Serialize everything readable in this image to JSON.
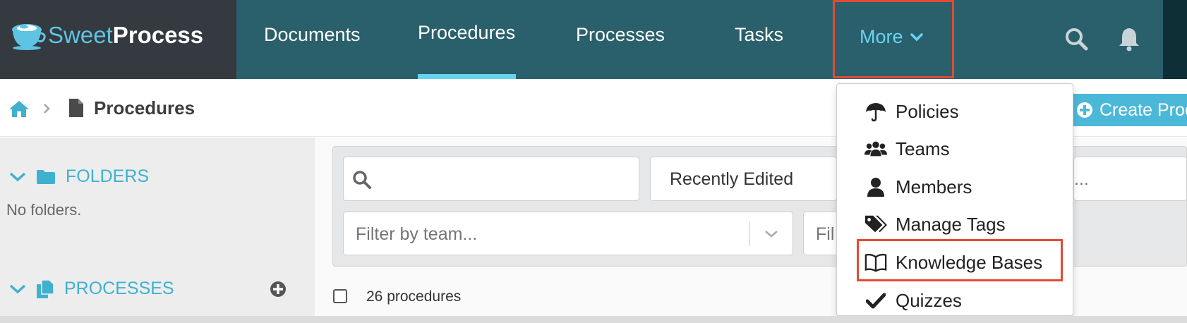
{
  "brand": {
    "part1": "Sweet",
    "part2": "Process",
    "logo_icon": "coffee-cup-logo"
  },
  "nav": {
    "items": [
      {
        "label": "Documents"
      },
      {
        "label": "Procedures",
        "active": true
      },
      {
        "label": "Processes"
      },
      {
        "label": "Tasks"
      }
    ],
    "more_label": "More",
    "search_icon": "search-icon",
    "bell_icon": "bell-icon",
    "accent_color": "#67d3ef",
    "nav_color": "#2a5f6c"
  },
  "breadcrumb": {
    "home_icon": "home-icon",
    "separator_icon": "chevron-right-icon",
    "page_icon": "file-icon",
    "title": "Procedures"
  },
  "create_button": {
    "label": "Create Proc"
  },
  "sidebar": {
    "folders": {
      "label": "FOLDERS",
      "empty_text": "No folders."
    },
    "processes": {
      "label": "PROCESSES"
    }
  },
  "filters": {
    "search_placeholder": "",
    "sort_value": "Recently Edited",
    "team_placeholder": "Filter by team...",
    "second_filter_partial": "Fil",
    "third_filter_partial": "..."
  },
  "list": {
    "count_text": "26 procedures"
  },
  "more_menu": {
    "items": [
      {
        "label": "Policies",
        "icon": "umbrella-icon"
      },
      {
        "label": "Teams",
        "icon": "users-icon"
      },
      {
        "label": "Members",
        "icon": "user-icon"
      },
      {
        "label": "Manage Tags",
        "icon": "tags-icon"
      },
      {
        "label": "Knowledge Bases",
        "icon": "book-open-icon",
        "highlighted": true
      },
      {
        "label": "Quizzes",
        "icon": "check-icon"
      }
    ]
  },
  "highlight_color": "#e24b33"
}
